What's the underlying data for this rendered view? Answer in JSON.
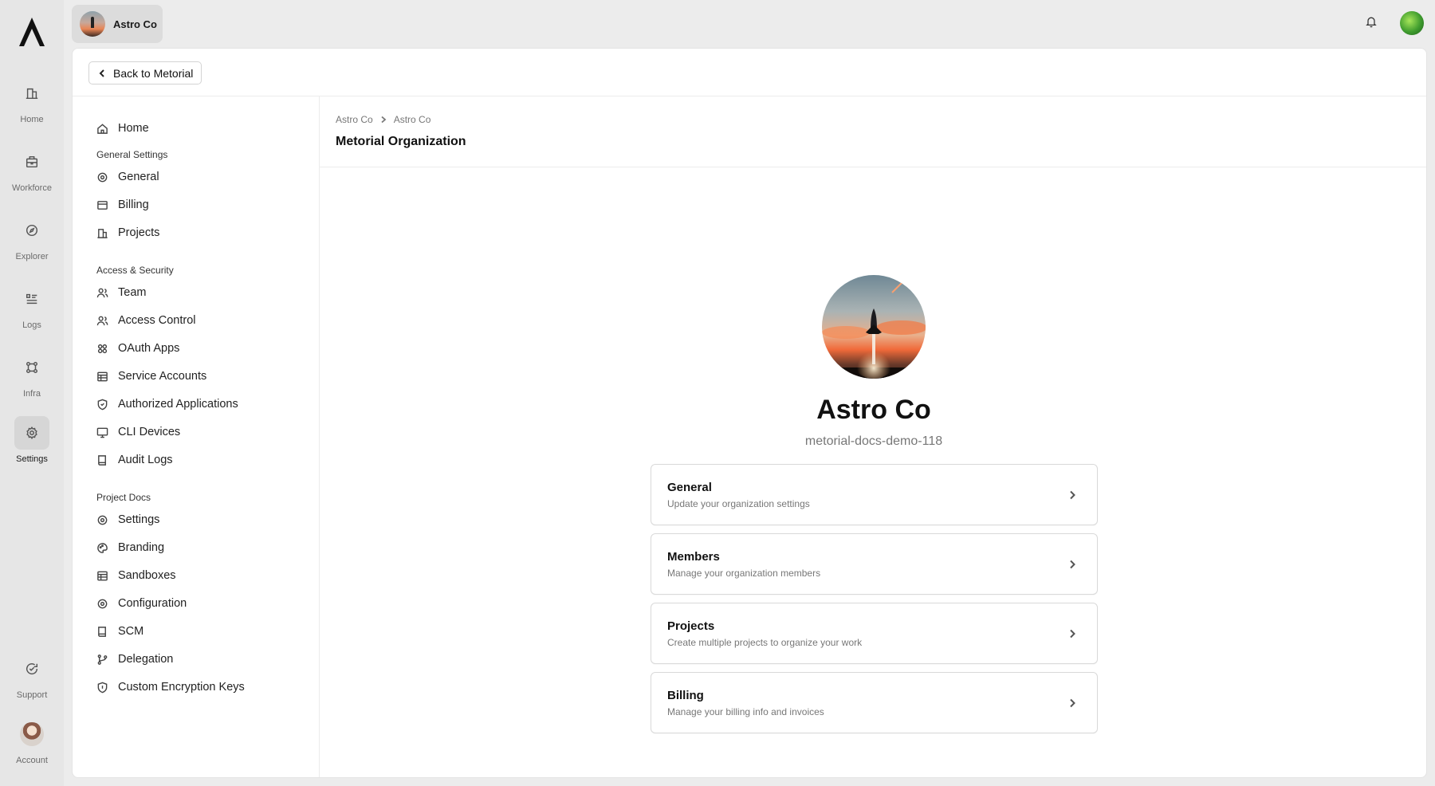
{
  "rail": {
    "items": [
      {
        "label": "Home",
        "icon": "building-icon"
      },
      {
        "label": "Workforce",
        "icon": "briefcase-icon"
      },
      {
        "label": "Explorer",
        "icon": "compass-icon"
      },
      {
        "label": "Logs",
        "icon": "list-icon"
      },
      {
        "label": "Infra",
        "icon": "nodes-icon"
      },
      {
        "label": "Settings",
        "icon": "gear-icon",
        "active": true
      }
    ],
    "support_label": "Support",
    "account_label": "Account"
  },
  "topbar": {
    "org_name": "Astro Co"
  },
  "panel": {
    "back_label": "Back to Metorial"
  },
  "sidebar": {
    "home_label": "Home",
    "sections": [
      {
        "title": "General Settings",
        "items": [
          {
            "label": "General",
            "icon": "gear-icon"
          },
          {
            "label": "Billing",
            "icon": "credit-card-icon"
          },
          {
            "label": "Projects",
            "icon": "building-icon"
          }
        ]
      },
      {
        "title": "Access & Security",
        "items": [
          {
            "label": "Team",
            "icon": "users-icon"
          },
          {
            "label": "Access Control",
            "icon": "users-icon"
          },
          {
            "label": "OAuth Apps",
            "icon": "apps-icon"
          },
          {
            "label": "Service Accounts",
            "icon": "table-icon"
          },
          {
            "label": "Authorized Applications",
            "icon": "shield-icon"
          },
          {
            "label": "CLI Devices",
            "icon": "monitor-icon"
          },
          {
            "label": "Audit Logs",
            "icon": "book-icon"
          }
        ]
      },
      {
        "title": "Project Docs",
        "items": [
          {
            "label": "Settings",
            "icon": "gear-icon"
          },
          {
            "label": "Branding",
            "icon": "palette-icon"
          },
          {
            "label": "Sandboxes",
            "icon": "table-icon"
          },
          {
            "label": "Configuration",
            "icon": "gear-icon"
          },
          {
            "label": "SCM",
            "icon": "book-icon"
          },
          {
            "label": "Delegation",
            "icon": "branch-icon"
          },
          {
            "label": "Custom Encryption Keys",
            "icon": "shield-icon"
          }
        ]
      }
    ]
  },
  "content": {
    "breadcrumbs": [
      "Astro Co",
      "Astro Co"
    ],
    "page_title": "Metorial Organization",
    "org_name": "Astro Co",
    "org_slug": "metorial-docs-demo-118",
    "cards": [
      {
        "title": "General",
        "desc": "Update your organization settings"
      },
      {
        "title": "Members",
        "desc": "Manage your organization members"
      },
      {
        "title": "Projects",
        "desc": "Create multiple projects to organize your work"
      },
      {
        "title": "Billing",
        "desc": "Manage your billing info and invoices"
      }
    ]
  }
}
